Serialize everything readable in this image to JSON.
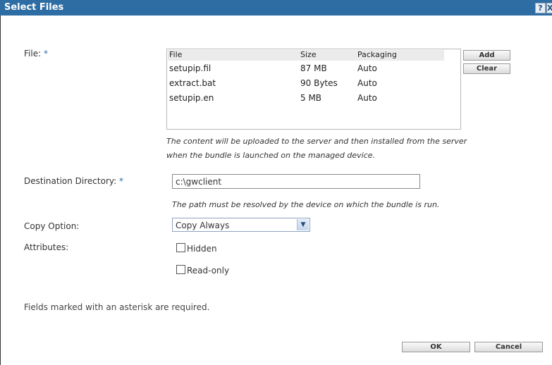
{
  "window": {
    "title": "Select Files",
    "help_label": "?",
    "close_label": "X"
  },
  "file": {
    "label": "File:",
    "required_mark": "*",
    "columns": [
      "File",
      "Size",
      "Packaging"
    ],
    "rows": [
      {
        "name": "setupip.fil",
        "size": "87 MB",
        "packaging": "Auto"
      },
      {
        "name": "extract.bat",
        "size": "90 Bytes",
        "packaging": "Auto"
      },
      {
        "name": "setupip.en",
        "size": "5 MB",
        "packaging": "Auto"
      }
    ],
    "add_label": "Add",
    "clear_label": "Clear",
    "note_line1": "The content will be uploaded to the server and then installed from the server",
    "note_line2": "when the bundle is launched on the managed device."
  },
  "destination": {
    "label": "Destination Directory:",
    "required_mark": "*",
    "value": "c:\\gwclient",
    "note": "The path must be resolved by the device on which the bundle is run."
  },
  "copy_option": {
    "label": "Copy Option:",
    "value": "Copy Always"
  },
  "attributes": {
    "label": "Attributes:",
    "hidden_label": "Hidden",
    "readonly_label": "Read-only"
  },
  "footer": {
    "required_note": "Fields marked with an asterisk are required.",
    "ok_label": "OK",
    "cancel_label": "Cancel"
  }
}
